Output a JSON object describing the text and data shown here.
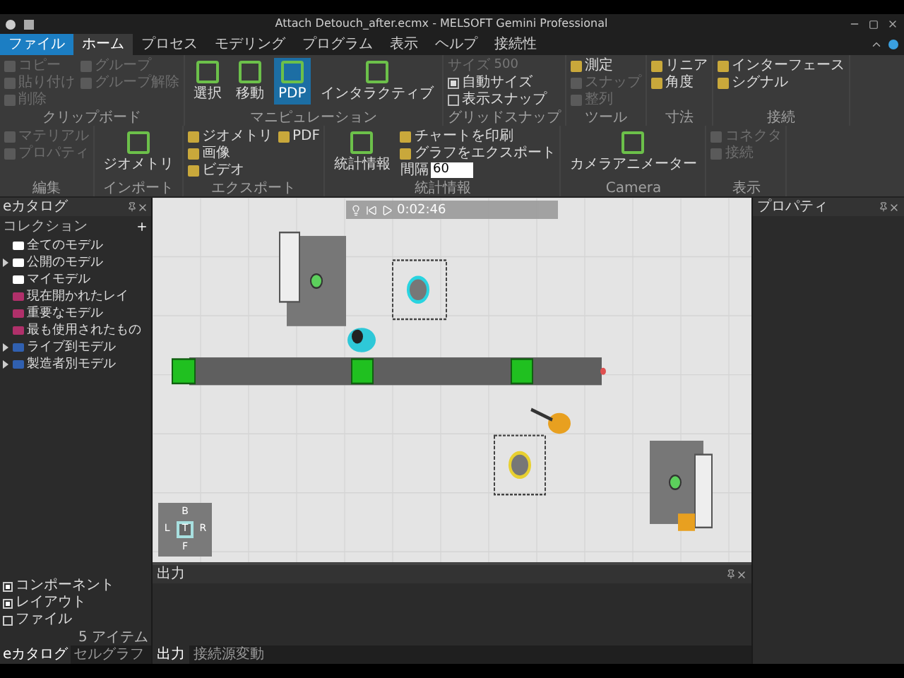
{
  "window": {
    "title": "Attach Detouch_after.ecmx - MELSOFT Gemini Professional"
  },
  "menu_tabs": [
    {
      "label": "ファイル",
      "kind": "file",
      "selected": false
    },
    {
      "label": "ホーム",
      "kind": "tab",
      "selected": true
    },
    {
      "label": "プロセス",
      "kind": "tab",
      "selected": false
    },
    {
      "label": "モデリング",
      "kind": "tab",
      "selected": false
    },
    {
      "label": "プログラム",
      "kind": "tab",
      "selected": false
    },
    {
      "label": "表示",
      "kind": "tab",
      "selected": false
    },
    {
      "label": "ヘルプ",
      "kind": "tab",
      "selected": false
    },
    {
      "label": "接続性",
      "kind": "tab",
      "selected": false
    }
  ],
  "ribbon": [
    {
      "label": "クリップボード",
      "items": [
        {
          "kind": "small",
          "label": "コピー",
          "disabled": true
        },
        {
          "kind": "small",
          "label": "貼り付け",
          "disabled": true
        },
        {
          "kind": "small",
          "label": "削除",
          "disabled": true
        },
        {
          "kind": "small",
          "label": "グループ",
          "disabled": true
        },
        {
          "kind": "small",
          "label": "グループ解除",
          "disabled": true
        }
      ]
    },
    {
      "label": "マニピュレーション",
      "items": [
        {
          "kind": "large",
          "label": "選択",
          "selected": false
        },
        {
          "kind": "large",
          "label": "移動",
          "selected": false
        },
        {
          "kind": "large",
          "label": "PDP",
          "selected": true
        },
        {
          "kind": "large",
          "label": "インタラクティブ",
          "selected": false
        }
      ]
    },
    {
      "label": "グリッドスナップ",
      "items": [
        {
          "kind": "field",
          "label": "サイズ",
          "value": "500",
          "disabled": true
        },
        {
          "kind": "check",
          "label": "自動サイズ",
          "checked": true
        },
        {
          "kind": "check",
          "label": "表示スナップ",
          "checked": false
        }
      ]
    },
    {
      "label": "ツール",
      "items": [
        {
          "kind": "small",
          "label": "測定",
          "disabled": false
        },
        {
          "kind": "small",
          "label": "スナップ",
          "disabled": true
        },
        {
          "kind": "small",
          "label": "整列",
          "disabled": true
        }
      ]
    },
    {
      "label": "寸法",
      "items": [
        {
          "kind": "small",
          "label": "リニア",
          "disabled": false
        },
        {
          "kind": "small",
          "label": "角度",
          "disabled": false
        }
      ]
    },
    {
      "label": "接続",
      "items": [
        {
          "kind": "small",
          "label": "インターフェース",
          "disabled": false
        },
        {
          "kind": "small",
          "label": "シグナル",
          "disabled": false
        }
      ]
    },
    {
      "label": "編集",
      "items": [
        {
          "kind": "small",
          "label": "マテリアル",
          "disabled": true
        },
        {
          "kind": "small",
          "label": "プロパティ",
          "disabled": true
        }
      ]
    },
    {
      "label": "インポート",
      "items": [
        {
          "kind": "large",
          "label": "ジオメトリ",
          "selected": false
        }
      ]
    },
    {
      "label": "エクスポート",
      "items": [
        {
          "kind": "small",
          "label": "ジオメトリ",
          "disabled": false
        },
        {
          "kind": "small",
          "label": "画像",
          "disabled": false
        },
        {
          "kind": "small",
          "label": "ビデオ",
          "disabled": false
        },
        {
          "kind": "small",
          "label": "PDF",
          "disabled": false
        }
      ]
    },
    {
      "label": "統計情報",
      "items": [
        {
          "kind": "large",
          "label": "統計情報",
          "selected": false
        },
        {
          "kind": "small",
          "label": "チャートを印刷",
          "disabled": false
        },
        {
          "kind": "small",
          "label": "グラフをエクスポート",
          "disabled": false
        },
        {
          "kind": "field",
          "label": "間隔",
          "value": "60",
          "disabled": false
        }
      ]
    },
    {
      "label": "Camera",
      "items": [
        {
          "kind": "large",
          "label": "カメラアニメーター",
          "selected": false
        }
      ]
    },
    {
      "label": "表示",
      "items": [
        {
          "kind": "small",
          "label": "コネクタ",
          "disabled": true
        },
        {
          "kind": "small",
          "label": "接続",
          "disabled": true
        }
      ]
    }
  ],
  "catalog": {
    "title": "eカタログ",
    "collection_label": "コレクション",
    "tree": [
      {
        "label": "全てのモデル",
        "color": "#ffffff",
        "expandable": false
      },
      {
        "label": "公開のモデル",
        "color": "#ffffff",
        "expandable": true
      },
      {
        "label": "マイモデル",
        "color": "#ffffff",
        "expandable": false
      },
      {
        "label": "現在開かれたレイ",
        "color": "#b0306a",
        "expandable": false
      },
      {
        "label": "重要なモデル",
        "color": "#b0306a",
        "expandable": false
      },
      {
        "label": "最も使用されたもの",
        "color": "#b0306a",
        "expandable": false
      },
      {
        "label": "ライブ到モデル",
        "color": "#3060b0",
        "expandable": true
      },
      {
        "label": "製造者別モデル",
        "color": "#3060b0",
        "expandable": true
      }
    ],
    "filters": [
      {
        "label": "コンポーネント",
        "checked": true
      },
      {
        "label": "レイアウト",
        "checked": true
      },
      {
        "label": "ファイル",
        "checked": false
      }
    ],
    "item_count": "5 アイテム",
    "tabs": [
      {
        "label": "eカタログ",
        "selected": true
      },
      {
        "label": "セルグラフ",
        "selected": false
      }
    ]
  },
  "viewport": {
    "playback_time": "0:02:46",
    "view_cube": {
      "top": "B",
      "left": "L",
      "center": "T",
      "right": "R",
      "bottom": "F"
    }
  },
  "output": {
    "title": "出力",
    "tabs": [
      {
        "label": "出力",
        "selected": true
      },
      {
        "label": "接続源変動",
        "selected": false
      }
    ]
  },
  "properties": {
    "title": "プロパティ"
  }
}
